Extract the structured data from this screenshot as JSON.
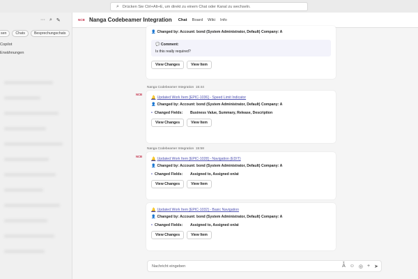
{
  "search": {
    "placeholder": "Drücken Sie Ctrl+Alt+E, um direkt zu einem Chat oder Kanal zu wechseln."
  },
  "sidebar": {
    "pills": [
      "sen",
      "Chats",
      "Besprechungschats"
    ],
    "items": [
      "Copilot",
      "Erwähnungen"
    ]
  },
  "header": {
    "app_logo": "NCB",
    "title": "Nanga Codebeamer Integration",
    "tabs": [
      "Chat",
      "Board",
      "Wiki",
      "Info"
    ]
  },
  "messages": {
    "first": {
      "changed_by": "Changed by: Account: bond (System Administrator, Default) Company: A",
      "comment_header": "💬 Comment:",
      "comment_text": "Is this really required?"
    },
    "second": {
      "sender": "Nanga Codebeamer Integration",
      "time": "15:44",
      "link": "Updated Work Item [EPIC-1036] - Speed Limit Indicator",
      "changed_by": "Changed by: Account: bond (System Administrator, Default) Company: A",
      "fields_label": "Changed Fields:",
      "fields_value": "Business Value, Summary, Release, Description"
    },
    "third": {
      "sender": "Nanga Codebeamer Integration",
      "time": "15:58",
      "link": "Updated Work Item [EPIC-1028] - Navigation (EDIT)",
      "changed_by": "Changed by: Account: bond (System Administrator, Default) Company: A",
      "fields_label": "Changed Fields:",
      "fields_value": "Assigned to, Assigned on/at"
    },
    "fourth": {
      "link": "Updated Work Item [EPIC-1032] - Basic Navigation",
      "changed_by": "Changed by: Account: bond (System Administrator, Default) Company: A",
      "fields_label": "Changed Fields:",
      "fields_value": "Assigned to, Assigned on/at"
    }
  },
  "buttons": {
    "view_changes": "View Changes",
    "view_item": "View Item"
  },
  "compose": {
    "placeholder": "Nachricht eingeben"
  },
  "icons": {
    "search": "search-icon",
    "more": "more-icon",
    "filter": "filter-icon",
    "new_chat": "new-chat-icon",
    "bell": "bell-icon",
    "person": "person-icon",
    "format": "format-icon",
    "emoji": "emoji-icon",
    "loop": "loop-icon",
    "attach": "attach-icon",
    "send": "send-icon"
  },
  "colors": {
    "accent": "#5b5fc7",
    "link": "#4f52b2",
    "app_logo": "#c4314b"
  }
}
